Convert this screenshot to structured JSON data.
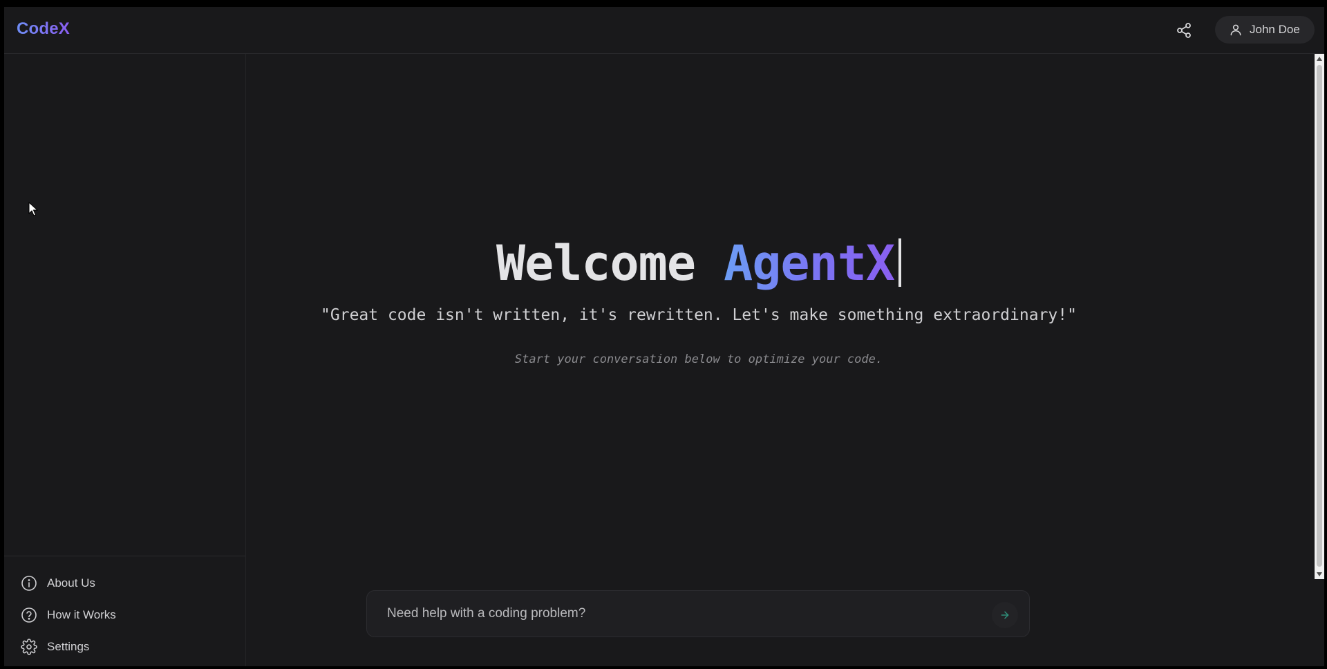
{
  "header": {
    "brand": "CodeX",
    "share_icon": "share-icon",
    "user_icon": "user-icon",
    "user_name": "John Doe"
  },
  "sidebar": {
    "items": [
      {
        "icon": "info-icon",
        "label": "About Us"
      },
      {
        "icon": "help-circle-icon",
        "label": "How it Works"
      },
      {
        "icon": "gear-icon",
        "label": "Settings"
      }
    ]
  },
  "main": {
    "welcome_prefix": "Welcome",
    "welcome_name": "AgentX",
    "quote": "\"Great code isn't written, it's rewritten. Let's make something extraordinary!\"",
    "subtitle": "Start your conversation below to optimize your code."
  },
  "chat": {
    "placeholder": "Need help with a coding problem?",
    "send_icon": "arrow-right-icon"
  },
  "colors": {
    "background": "#19191b",
    "brand_gradient_start": "#6f8ef5",
    "brand_gradient_end": "#8a5df2",
    "send_arrow": "#2f8f7a"
  }
}
